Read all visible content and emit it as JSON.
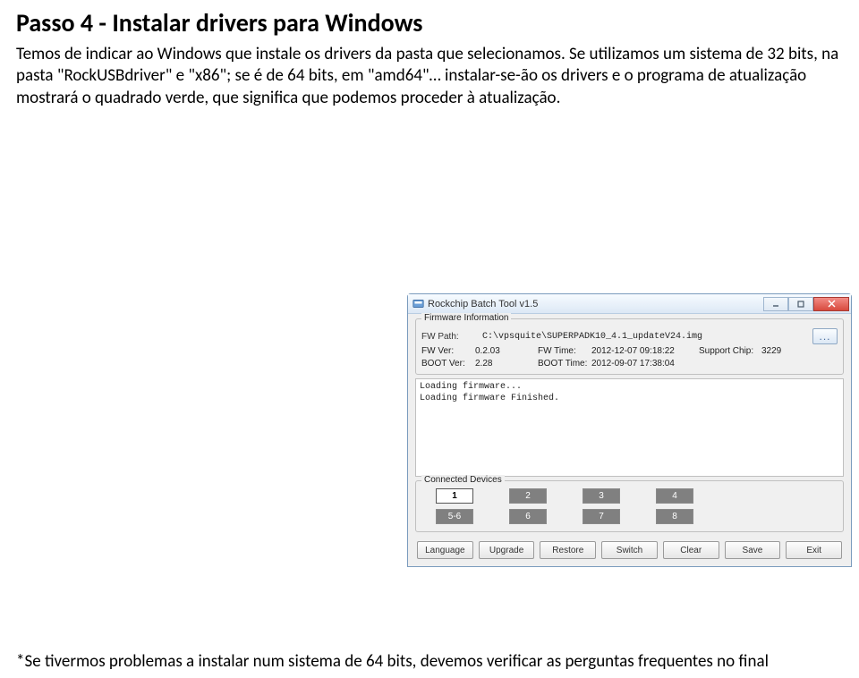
{
  "title": "Passo 4 - Instalar drivers para Windows",
  "paragraph1": "Temos de indicar ao Windows que instale os drivers da pasta que selecionamos. Se utilizamos um sistema de 32 bits, na pasta \"RockUSBdriver\" e \"x86\"; se é de 64 bits, em \"amd64\"… instalar-se-ão os drivers e o programa de atualização mostrará o quadrado verde, que significa que podemos proceder à atualização.",
  "footer": "*Se tivermos problemas a instalar num sistema de 64 bits, devemos verificar as perguntas frequentes no final",
  "app": {
    "window_title": "Rockchip Batch Tool v1.5",
    "firmware_group": "Firmware Information",
    "labels": {
      "fw_path": "FW Path:",
      "fw_ver": "FW Ver:",
      "boot_ver": "BOOT Ver:",
      "fw_time": "FW Time:",
      "boot_time": "BOOT Time:",
      "support_chip": "Support Chip:"
    },
    "values": {
      "fw_path": "C:\\vpsquite\\SUPERPADK10_4.1_updateV24.img",
      "fw_ver": "0.2.03",
      "boot_ver": "2.28",
      "fw_time": "2012-12-07 09:18:22",
      "boot_time": "2012-09-07 17:38:04",
      "support_chip": "3229"
    },
    "browse": "...",
    "log_line1": "Loading firmware...",
    "log_line2": "Loading firmware Finished.",
    "connected_group": "Connected Devices",
    "devices": [
      "1",
      "2",
      "3",
      "4",
      "5-6",
      "6",
      "7",
      "8"
    ],
    "buttons": [
      "Language",
      "Upgrade",
      "Restore",
      "Switch",
      "Clear",
      "Save",
      "Exit"
    ]
  }
}
